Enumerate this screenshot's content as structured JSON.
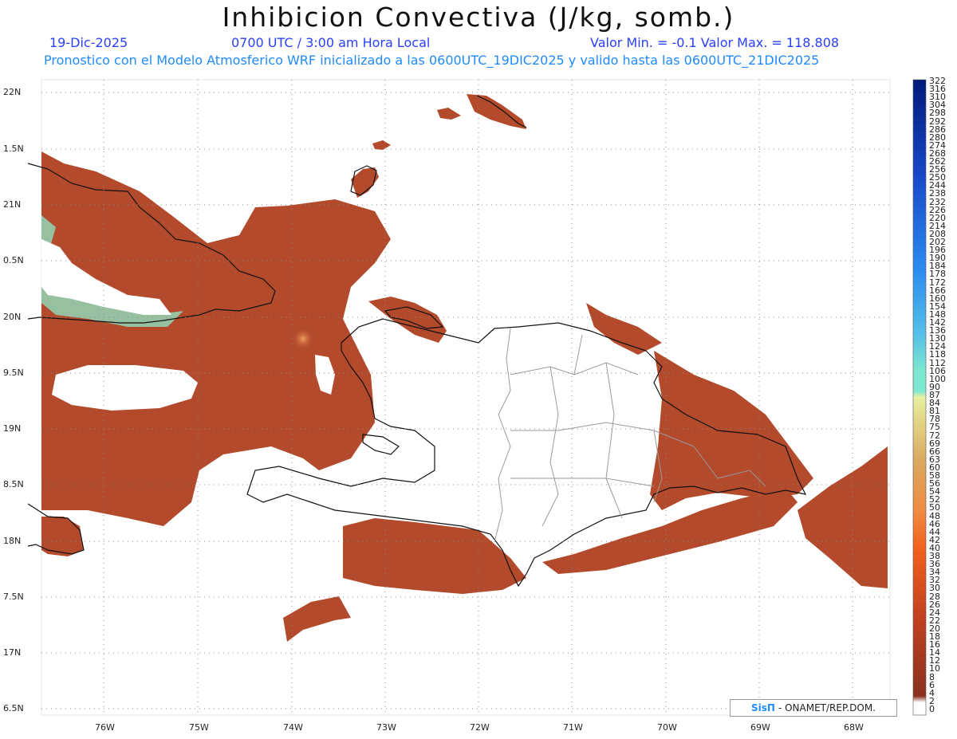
{
  "header": {
    "title": "Inhibicion Convectiva (J/kg, somb.)",
    "date": "19-Dic-2025",
    "time": "0700 UTC / 3:00 am Hora Local",
    "minmax": "Valor Min. = -0.1  Valor Max. = 118.808",
    "forecast_info": "Pronostico con el Modelo Atmosferico WRF inicializado a las 0600UTC_19DIC2025 y valido hasta las  0600UTC_21DIC2025"
  },
  "axes": {
    "lat_labels": [
      "22N",
      "1.5N",
      "21N",
      "0.5N",
      "20N",
      "9.5N",
      "19N",
      "8.5N",
      "18N",
      "7.5N",
      "17N",
      "6.5N"
    ],
    "lon_labels": [
      "76W",
      "75W",
      "74W",
      "73W",
      "72W",
      "71W",
      "70W",
      "69W",
      "68W"
    ]
  },
  "colorbar": {
    "labels": [
      "322",
      "316",
      "310",
      "304",
      "298",
      "292",
      "286",
      "280",
      "274",
      "268",
      "262",
      "256",
      "250",
      "244",
      "238",
      "232",
      "226",
      "220",
      "214",
      "208",
      "202",
      "196",
      "190",
      "184",
      "178",
      "172",
      "166",
      "160",
      "154",
      "148",
      "142",
      "136",
      "130",
      "124",
      "118",
      "112",
      "106",
      "100",
      "90",
      "87",
      "84",
      "81",
      "78",
      "75",
      "72",
      "69",
      "66",
      "63",
      "60",
      "58",
      "56",
      "54",
      "52",
      "50",
      "48",
      "46",
      "44",
      "42",
      "40",
      "38",
      "36",
      "34",
      "32",
      "30",
      "28",
      "26",
      "24",
      "22",
      "20",
      "18",
      "16",
      "14",
      "12",
      "10",
      "8",
      "6",
      "4",
      "2",
      "0"
    ]
  },
  "credit": {
    "logo": "SisΠ",
    "text": "- ONAMET/REP.DOM."
  },
  "colors": {
    "sea_cin": "#b24a2b",
    "coast": "#111111",
    "border": "#9a9a9a",
    "high_cin": "#8ee8c8"
  }
}
